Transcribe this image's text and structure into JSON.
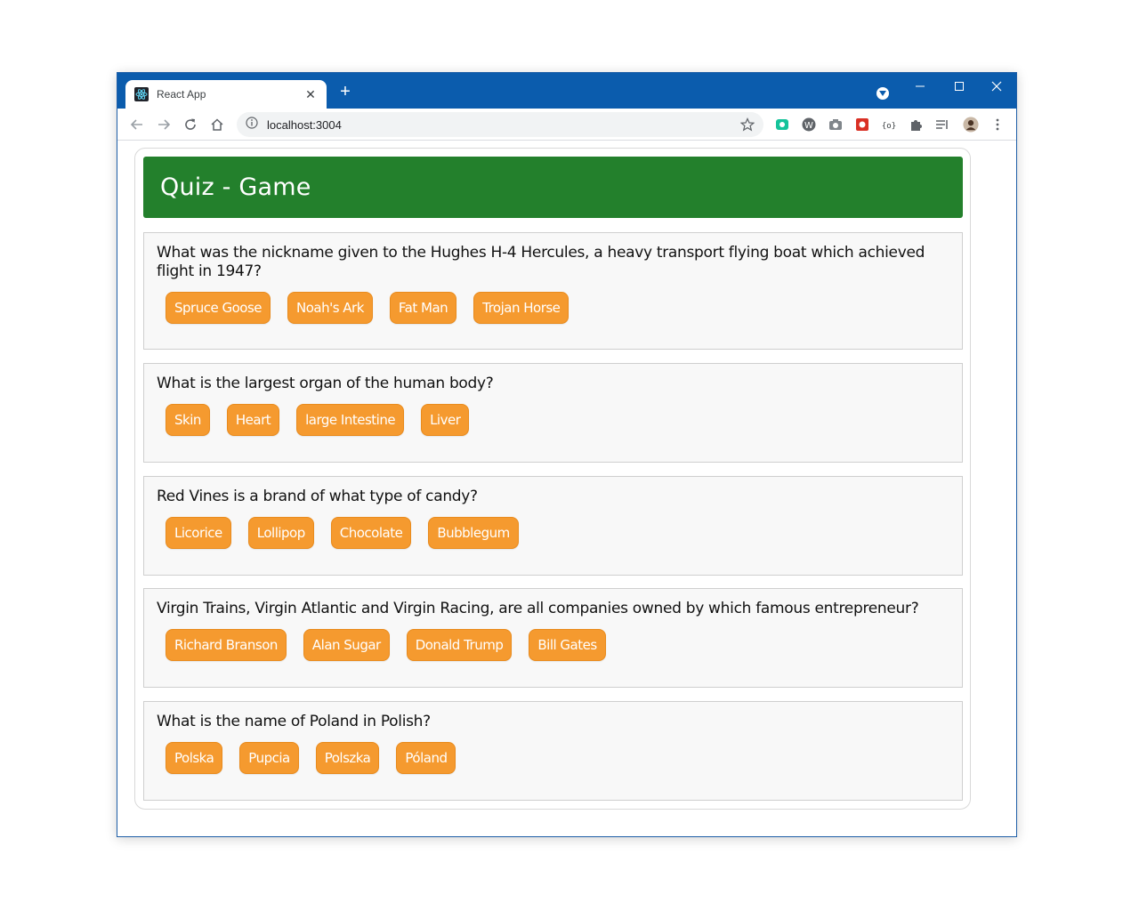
{
  "browser": {
    "tab": {
      "title": "React App",
      "close_label": "✕"
    },
    "new_tab_label": "+",
    "address_bar": {
      "url": "localhost:3004"
    },
    "window_controls": {
      "minimize_icon": "minimize-icon",
      "maximize_icon": "maximize-icon",
      "close_icon": "close-icon"
    }
  },
  "app": {
    "title": "Quiz - Game",
    "colors": {
      "header": "#23802c",
      "answer_button": "#f59a2f"
    },
    "questions": [
      {
        "text": "What was the nickname given to the Hughes H-4 Hercules, a heavy transport flying boat which achieved flight in 1947?",
        "answers": [
          "Spruce Goose",
          "Noah's Ark",
          "Fat Man",
          "Trojan Horse"
        ]
      },
      {
        "text": "What is the largest organ of the human body?",
        "answers": [
          "Skin",
          "Heart",
          "large Intestine",
          "Liver"
        ]
      },
      {
        "text": "Red Vines is a brand of what type of candy?",
        "answers": [
          "Licorice",
          "Lollipop",
          "Chocolate",
          "Bubblegum"
        ]
      },
      {
        "text": "Virgin Trains, Virgin Atlantic and Virgin Racing, are all companies owned by which famous entrepreneur?",
        "answers": [
          "Richard Branson",
          "Alan Sugar",
          "Donald Trump",
          "Bill Gates"
        ]
      },
      {
        "text": "What is the name of Poland in Polish?",
        "answers": [
          "Polska",
          "Pupcia",
          "Polszka",
          "Póland"
        ]
      }
    ]
  }
}
